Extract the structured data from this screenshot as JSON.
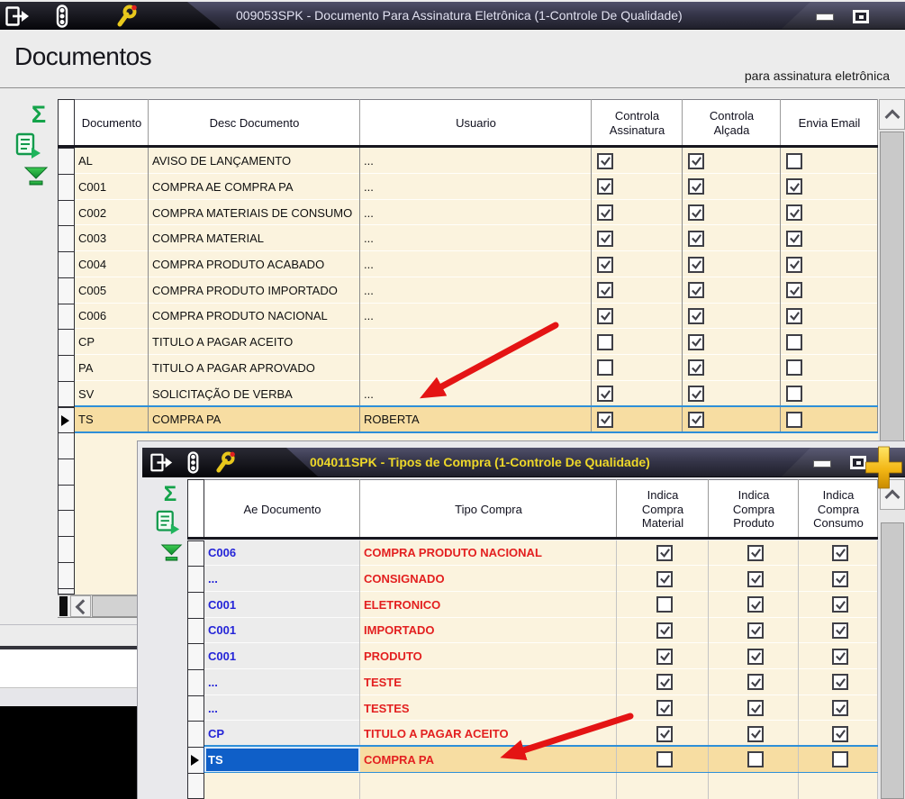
{
  "window1": {
    "title": "009053SPK - Documento Para Assinatura Eletrônica (1-Controle De Qualidade)",
    "heading": "Documentos",
    "subtitle": "para assinatura eletrônica",
    "columns": [
      "Documento",
      "Desc Documento",
      "Usuario",
      "Controla Assinatura",
      "Controla Alçada",
      "Envia Email"
    ],
    "rows": [
      {
        "documento": "AL",
        "desc": "AVISO DE LANÇAMENTO",
        "usuario": "...",
        "controla_assinatura": true,
        "controla_alcada": true,
        "envia_email": false,
        "selected": false
      },
      {
        "documento": "C001",
        "desc": "COMPRA AE COMPRA PA",
        "usuario": "...",
        "controla_assinatura": true,
        "controla_alcada": true,
        "envia_email": true,
        "selected": false
      },
      {
        "documento": "C002",
        "desc": "COMPRA MATERIAIS DE CONSUMO",
        "usuario": "...",
        "controla_assinatura": true,
        "controla_alcada": true,
        "envia_email": true,
        "selected": false
      },
      {
        "documento": "C003",
        "desc": "COMPRA MATERIAL",
        "usuario": "...",
        "controla_assinatura": true,
        "controla_alcada": true,
        "envia_email": true,
        "selected": false
      },
      {
        "documento": "C004",
        "desc": "COMPRA PRODUTO ACABADO",
        "usuario": "...",
        "controla_assinatura": true,
        "controla_alcada": true,
        "envia_email": true,
        "selected": false
      },
      {
        "documento": "C005",
        "desc": "COMPRA PRODUTO IMPORTADO",
        "usuario": "...",
        "controla_assinatura": true,
        "controla_alcada": true,
        "envia_email": true,
        "selected": false
      },
      {
        "documento": "C006",
        "desc": "COMPRA PRODUTO NACIONAL",
        "usuario": "...",
        "controla_assinatura": true,
        "controla_alcada": true,
        "envia_email": true,
        "selected": false
      },
      {
        "documento": "CP",
        "desc": "TITULO A PAGAR ACEITO",
        "usuario": "",
        "controla_assinatura": false,
        "controla_alcada": true,
        "envia_email": false,
        "selected": false
      },
      {
        "documento": "PA",
        "desc": "TITULO A PAGAR APROVADO",
        "usuario": "",
        "controla_assinatura": false,
        "controla_alcada": true,
        "envia_email": false,
        "selected": false
      },
      {
        "documento": "SV",
        "desc": "SOLICITAÇÃO DE VERBA",
        "usuario": "...",
        "controla_assinatura": true,
        "controla_alcada": true,
        "envia_email": false,
        "selected": false
      },
      {
        "documento": "TS",
        "desc": "COMPRA PA",
        "usuario": "ROBERTA",
        "controla_assinatura": true,
        "controla_alcada": true,
        "envia_email": false,
        "selected": true
      }
    ]
  },
  "window2": {
    "title": "004011SPK - Tipos de Compra (1-Controle De Qualidade)",
    "columns": [
      "Ae Documento",
      "Tipo Compra",
      "Indica Compra Material",
      "Indica Compra Produto",
      "Indica Compra Consumo"
    ],
    "rows": [
      {
        "ae_documento": "C006",
        "tipo_compra": "COMPRA PRODUTO NACIONAL",
        "indica_compra_material": true,
        "indica_compra_produto": true,
        "indica_compra_consumo": true,
        "selected": false
      },
      {
        "ae_documento": "...",
        "tipo_compra": "CONSIGNADO",
        "indica_compra_material": true,
        "indica_compra_produto": true,
        "indica_compra_consumo": true,
        "selected": false
      },
      {
        "ae_documento": "C001",
        "tipo_compra": "ELETRONICO",
        "indica_compra_material": false,
        "indica_compra_produto": true,
        "indica_compra_consumo": true,
        "selected": false
      },
      {
        "ae_documento": "C001",
        "tipo_compra": "IMPORTADO",
        "indica_compra_material": true,
        "indica_compra_produto": true,
        "indica_compra_consumo": true,
        "selected": false
      },
      {
        "ae_documento": "C001",
        "tipo_compra": "PRODUTO",
        "indica_compra_material": true,
        "indica_compra_produto": true,
        "indica_compra_consumo": true,
        "selected": false
      },
      {
        "ae_documento": "...",
        "tipo_compra": "TESTE",
        "indica_compra_material": true,
        "indica_compra_produto": true,
        "indica_compra_consumo": true,
        "selected": false
      },
      {
        "ae_documento": "...",
        "tipo_compra": "TESTES",
        "indica_compra_material": true,
        "indica_compra_produto": true,
        "indica_compra_consumo": true,
        "selected": false
      },
      {
        "ae_documento": "CP",
        "tipo_compra": "TITULO A PAGAR ACEITO",
        "indica_compra_material": true,
        "indica_compra_produto": true,
        "indica_compra_consumo": true,
        "selected": false
      },
      {
        "ae_documento": "TS",
        "tipo_compra": "COMPRA PA",
        "indica_compra_material": false,
        "indica_compra_produto": false,
        "indica_compra_consumo": false,
        "selected": true
      }
    ]
  },
  "icons": {
    "exit": "door-exit",
    "traffic_light": "traffic-light",
    "wrench": "wrench",
    "sum": "Σ",
    "export": "export-grid",
    "filter": "funnel-down",
    "scroll_up": "^",
    "scroll_left": "<",
    "add": "+",
    "row_marker": "▶",
    "checkbox_checked": "✓"
  },
  "colors": {
    "cream_row": "#FBF3DE",
    "gray_cell": "#ECECEC",
    "selected_row": "#F7DDA2",
    "selection_border": "#2E8FD8",
    "selected_cell_blue": "#0F5FC8",
    "blue_value_text": "#2424D8",
    "red_value_text": "#E32020",
    "title_text_w1": "#E2E2F2",
    "title_text_w2": "#EED829",
    "arrow_red": "#E41414",
    "check_mark": "#3F3F46"
  }
}
